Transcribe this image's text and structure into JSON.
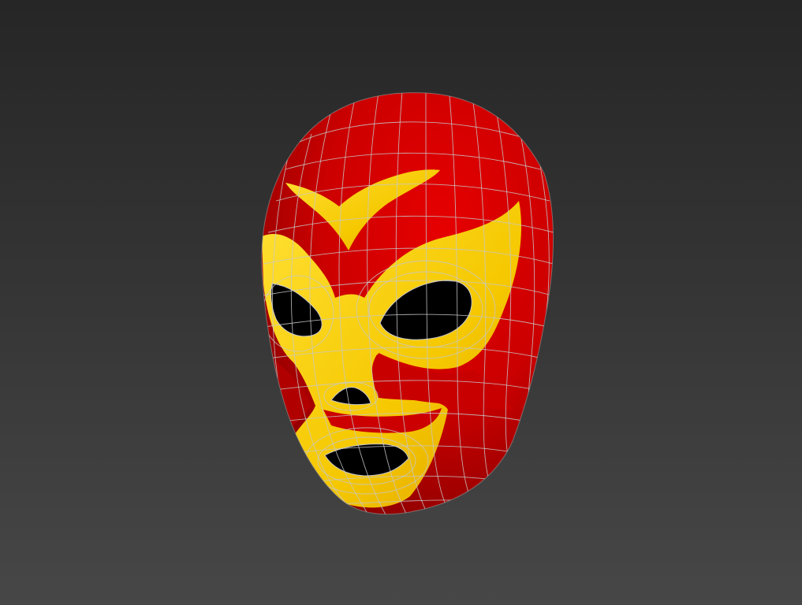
{
  "viewport": {
    "background_top": "#262626",
    "background_bottom": "#474747"
  },
  "model": {
    "subject": "mask-icon",
    "base_color": "#d40000",
    "accent_color": "#ffd400",
    "wire_color": "#c8c8c8",
    "opening_color": "#000000",
    "wireframe_visible": true
  }
}
